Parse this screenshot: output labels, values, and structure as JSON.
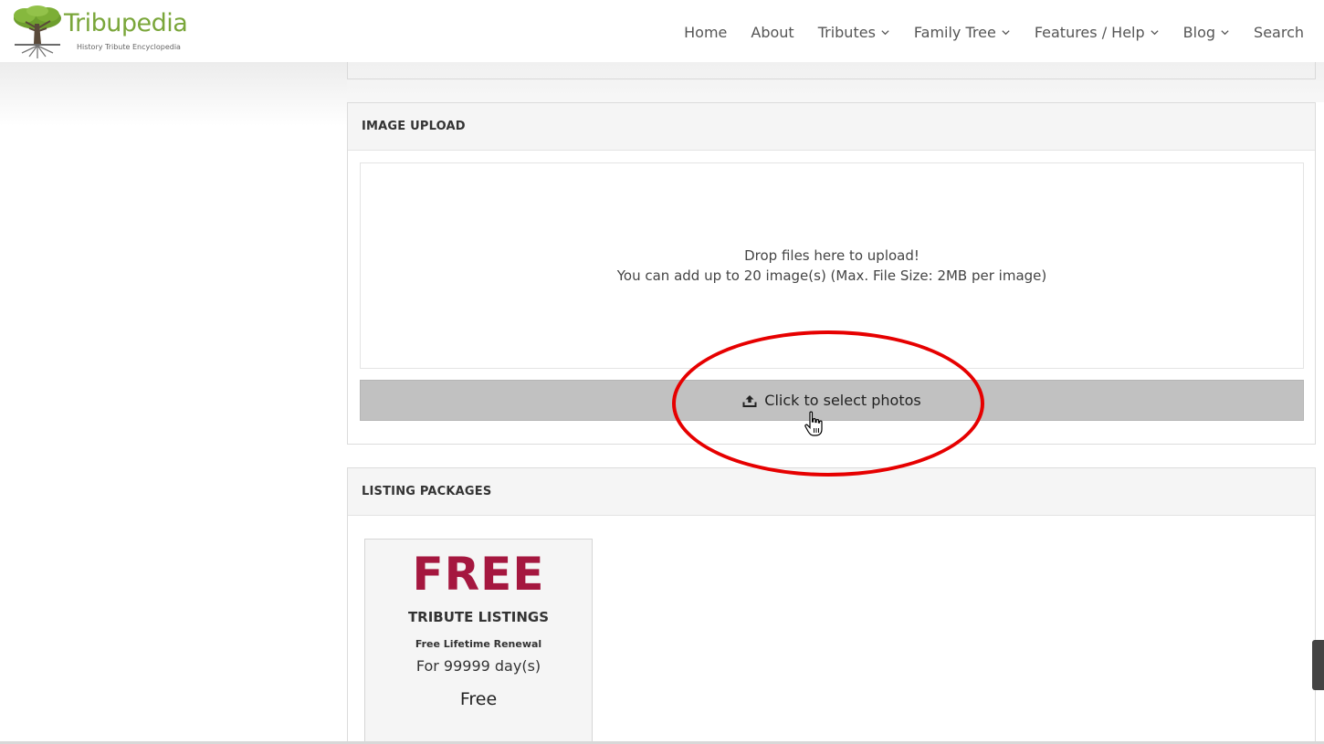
{
  "brand": {
    "name": "Tribupedia",
    "tagline": "History Tribute Encyclopedia",
    "color": "#7aa63a"
  },
  "nav": {
    "items": [
      {
        "label": "Home",
        "dropdown": false
      },
      {
        "label": "About",
        "dropdown": false
      },
      {
        "label": "Tributes",
        "dropdown": true
      },
      {
        "label": "Family Tree",
        "dropdown": true
      },
      {
        "label": "Features / Help",
        "dropdown": true
      },
      {
        "label": "Blog",
        "dropdown": true
      },
      {
        "label": "Search",
        "dropdown": false
      }
    ]
  },
  "image_upload": {
    "heading": "IMAGE UPLOAD",
    "drop_line1": "Drop files here to upload!",
    "drop_line2": "You can add up to 20 image(s) (Max. File Size: 2MB per image)",
    "button_label": "Click to select photos",
    "button_icon": "upload-icon"
  },
  "listing_packages": {
    "heading": "LISTING PACKAGES",
    "package": {
      "price_title": "FREE",
      "type": "TRIBUTE LISTINGS",
      "renewal": "Free Lifetime Renewal",
      "duration": "For 99999 day(s)",
      "cost": "Free",
      "accent_color": "#a5173f"
    }
  },
  "annotation": {
    "color": "#e60000"
  }
}
